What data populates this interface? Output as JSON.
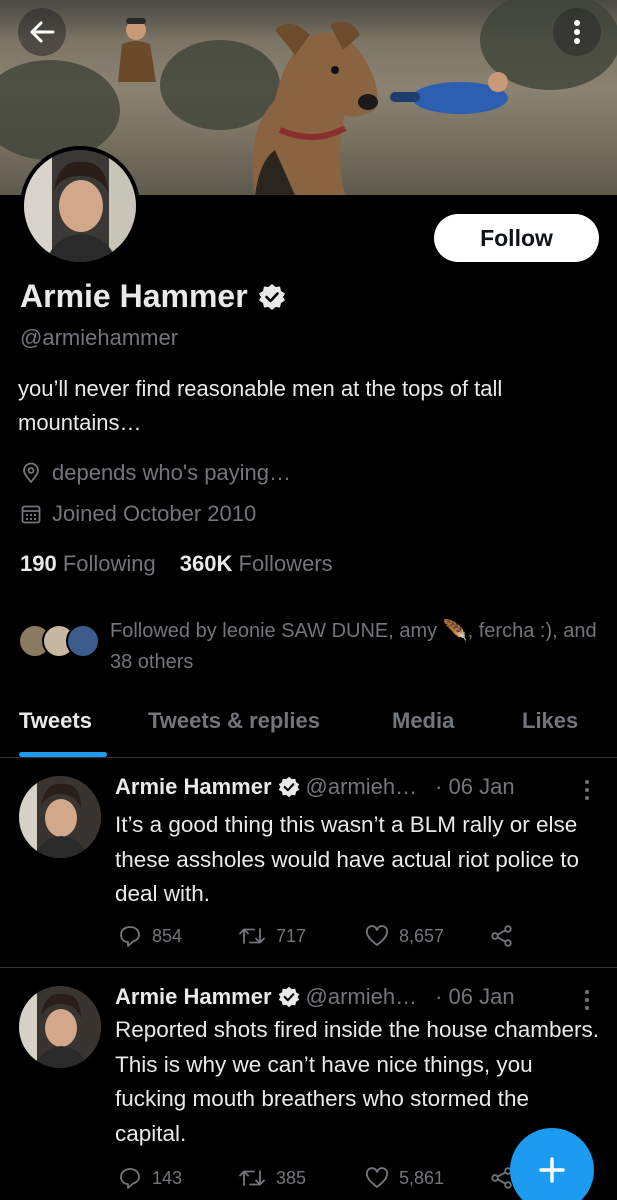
{
  "profile": {
    "name": "Armie Hammer",
    "handle": "@armiehammer",
    "bio": "you’ll never find reasonable men at the tops of tall mountains…",
    "location": "depends who's paying…",
    "joined": "Joined October 2010",
    "following_count": "190",
    "following_label": "Following",
    "followers_count": "360K",
    "followers_label": "Followers",
    "followed_by": "Followed by leonie SAW DUNE, amy",
    "followed_by_emoji": "🪶",
    "followed_by_more": ", fercha :), and 38 others"
  },
  "buttons": {
    "follow": "Follow",
    "compose": "+"
  },
  "tabs": [
    "Tweets",
    "Tweets & replies",
    "Media",
    "Likes"
  ],
  "tweets": [
    {
      "name": "Armie Hammer",
      "handle": "@armieh…",
      "date": "· 06 Jan",
      "text": "It’s a good thing this wasn’t a BLM rally or else these assholes would have actual riot police to deal with.",
      "replies": "854",
      "retweets": "717",
      "likes": "8,657"
    },
    {
      "name": "Armie Hammer",
      "handle": "@armieh…",
      "date": "· 06 Jan",
      "text": "Reported shots fired inside the house chambers. This is why we can’t have nice things, you fucking mouth breathers who stormed the capital.",
      "replies": "143",
      "retweets": "385",
      "likes": "5,861"
    }
  ],
  "colors": {
    "accent": "#1d9bf0",
    "background": "#000000",
    "text": "#e7e9ea",
    "muted": "#71767b",
    "border": "#2f3336"
  }
}
